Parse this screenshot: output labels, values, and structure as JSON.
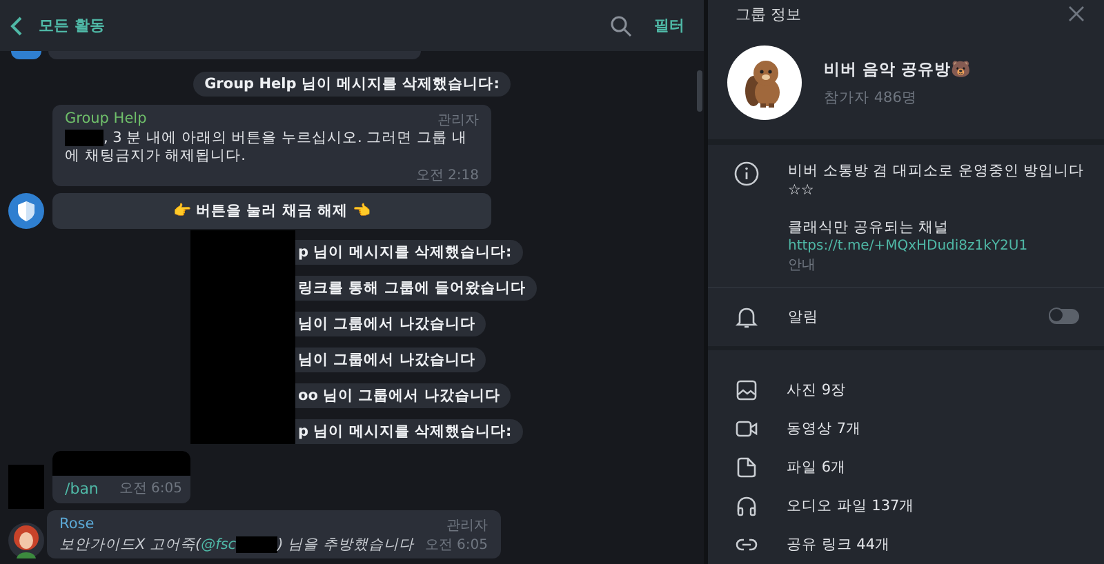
{
  "chat_header": {
    "back_label": "모든 활동",
    "filter_label": "필터"
  },
  "messages": [
    {
      "kind": "partial"
    },
    {
      "kind": "service",
      "text": "Group Help 님이 메시지를 삭제했습니다:",
      "redacted": false
    },
    {
      "kind": "message",
      "sender": "Group Help",
      "role": "관리자",
      "redacted_prefix": true,
      "text": ", 3 분 내에 아래의 버튼을 누르십시오. 그러면 그룹 내에 채팅금지가 해제됩니다.",
      "time": "오전 2:18"
    },
    {
      "kind": "inline_button",
      "label": "👉 버튼을 눌러 채금 해제 👈"
    },
    {
      "kind": "service",
      "text": "p 님이 메시지를 삭제했습니다:",
      "redacted": true
    },
    {
      "kind": "service",
      "text": "링크를 통해 그룹에 들어왔습니다",
      "redacted": true
    },
    {
      "kind": "service",
      "text": "님이 그룹에서 나갔습니다",
      "redacted": true
    },
    {
      "kind": "service",
      "text": "님이 그룹에서 나갔습니다",
      "redacted": true
    },
    {
      "kind": "service",
      "text": "oo 님이 그룹에서 나갔습니다",
      "redacted": true
    },
    {
      "kind": "service",
      "text": "p 님이 메시지를 삭제했습니다:",
      "redacted": true
    },
    {
      "kind": "command",
      "text": "/ban",
      "time": "오전 6:05"
    },
    {
      "kind": "ban_notice",
      "sender": "Rose",
      "role": "관리자",
      "before": "보안가이드X 고어죽(",
      "mention": "@fsc",
      "after": ") 님을 추방했습니다",
      "time": "오전 6:05"
    }
  ],
  "info_panel": {
    "title": "그룹 정보",
    "group_name": "비버 음악 공유방🐻",
    "members": "참가자 486명",
    "description": "비버 소통방 겸 대피소로 운영중인 방입니다 ☆☆",
    "subtitle": "클래식만 공유되는 채널",
    "link": "https://t.me/+MQxHDudi8z1kY2U1",
    "description_label": "안내",
    "notifications": {
      "label": "알림",
      "on": false
    },
    "media": [
      {
        "kind": "photo",
        "label": "사진 9장"
      },
      {
        "kind": "video",
        "label": "동영상 7개"
      },
      {
        "kind": "file",
        "label": "파일 6개"
      },
      {
        "kind": "audio",
        "label": "오디오 파일 137개"
      },
      {
        "kind": "link",
        "label": "공유 링크 44개"
      }
    ]
  }
}
